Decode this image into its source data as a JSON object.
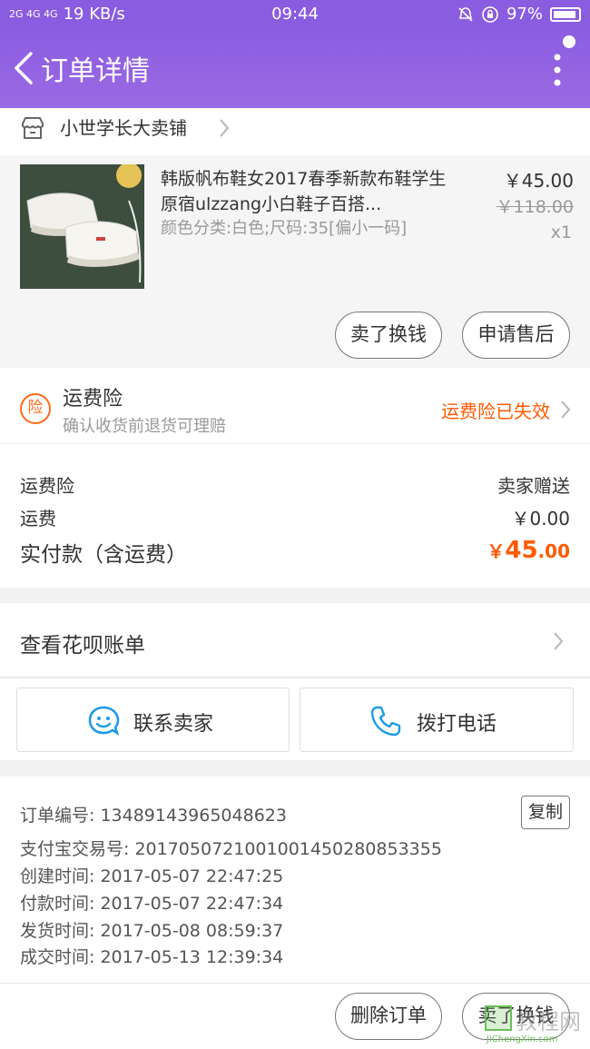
{
  "status_bar": {
    "signal_text": "2G 4G 4G",
    "speed": "19 KB/s",
    "time": "09:44",
    "battery": "97%"
  },
  "nav": {
    "title": "订单详情"
  },
  "shop": {
    "name": "小世学长大卖铺"
  },
  "item": {
    "title": "韩版帆布鞋女2017春季新款布鞋学生原宿ulzzang小白鞋子百搭...",
    "sku": "颜色分类:白色;尺码:35[偏小一码]",
    "price": "￥45.00",
    "original_price": "￥118.00",
    "quantity": "x1",
    "sell_button": "卖了换钱",
    "after_sale_button": "申请售后"
  },
  "insurance": {
    "badge": "险",
    "title": "运费险",
    "subtitle": "确认收货前退货可理赔",
    "status": "运费险已失效"
  },
  "summary": {
    "insurance_label": "运费险",
    "insurance_value": "卖家赠送",
    "shipping_label": "运费",
    "shipping_value": "￥0.00",
    "paid_label": "实付款（含运费）",
    "paid_symbol": "￥",
    "paid_int": "45",
    "paid_dec": ".00"
  },
  "huabei": {
    "label": "查看花呗账单"
  },
  "contact": {
    "seller_label": "联系卖家",
    "phone_label": "拨打电话"
  },
  "order_info": {
    "order_no_label": "订单编号: ",
    "order_no": "13489143965048623",
    "copy_label": "复制",
    "alipay_label": "支付宝交易号: ",
    "alipay_no": "2017050721001001450280853355",
    "created_label": "创建时间: ",
    "created": "2017-05-07 22:47:25",
    "paid_label": "付款时间: ",
    "paid": "2017-05-07 22:47:34",
    "shipped_label": "发货时间: ",
    "shipped": "2017-05-08 08:59:37",
    "completed_label": "成交时间: ",
    "completed": "2017-05-13 12:39:34"
  },
  "bottom": {
    "delete_button": "删除订单",
    "sell_button": "卖了换钱"
  },
  "watermark": {
    "text": "教程网",
    "sub": "JiChengXin.com"
  },
  "colors": {
    "header": "#8b5de2",
    "accent_orange": "#ff5a00",
    "icon_blue": "#1e9be8"
  }
}
